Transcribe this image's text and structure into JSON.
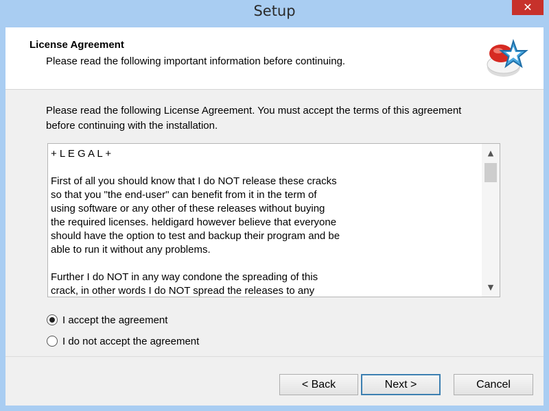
{
  "window": {
    "title": "Setup",
    "close_glyph": "✕"
  },
  "header": {
    "title": "License Agreement",
    "subtitle": "Please read the following important information before continuing.",
    "logo_icon": "setup-wizard-logo"
  },
  "main": {
    "intro": "Please read the following License Agreement. You must accept the terms of this agreement before continuing with the installation.",
    "license_text": "+ L E G A L +\n\nFirst of all you should know that I do NOT release these cracks\nso that you \"the end-user\" can benefit from it in the term of\nusing software or any other of these releases without buying\nthe required licenses. heldigard however believe that everyone\nshould have the option to test and backup their program and be\nable to run it without any problems.\n\nFurther I do NOT in any way condone the spreading of this\ncrack, in other words I do NOT spread the releases to any",
    "scroll_up_glyph": "▲",
    "scroll_down_glyph": "▼",
    "options": [
      {
        "label": "I accept the agreement",
        "selected": true
      },
      {
        "label": "I do not accept the agreement",
        "selected": false
      }
    ]
  },
  "buttons": {
    "back_label": "< Back",
    "next_label": "Next >",
    "cancel_label": "Cancel"
  },
  "colors": {
    "title_bar": "#a9cdf2",
    "close_button": "#c7312b",
    "primary_border": "#3c7fb1"
  }
}
